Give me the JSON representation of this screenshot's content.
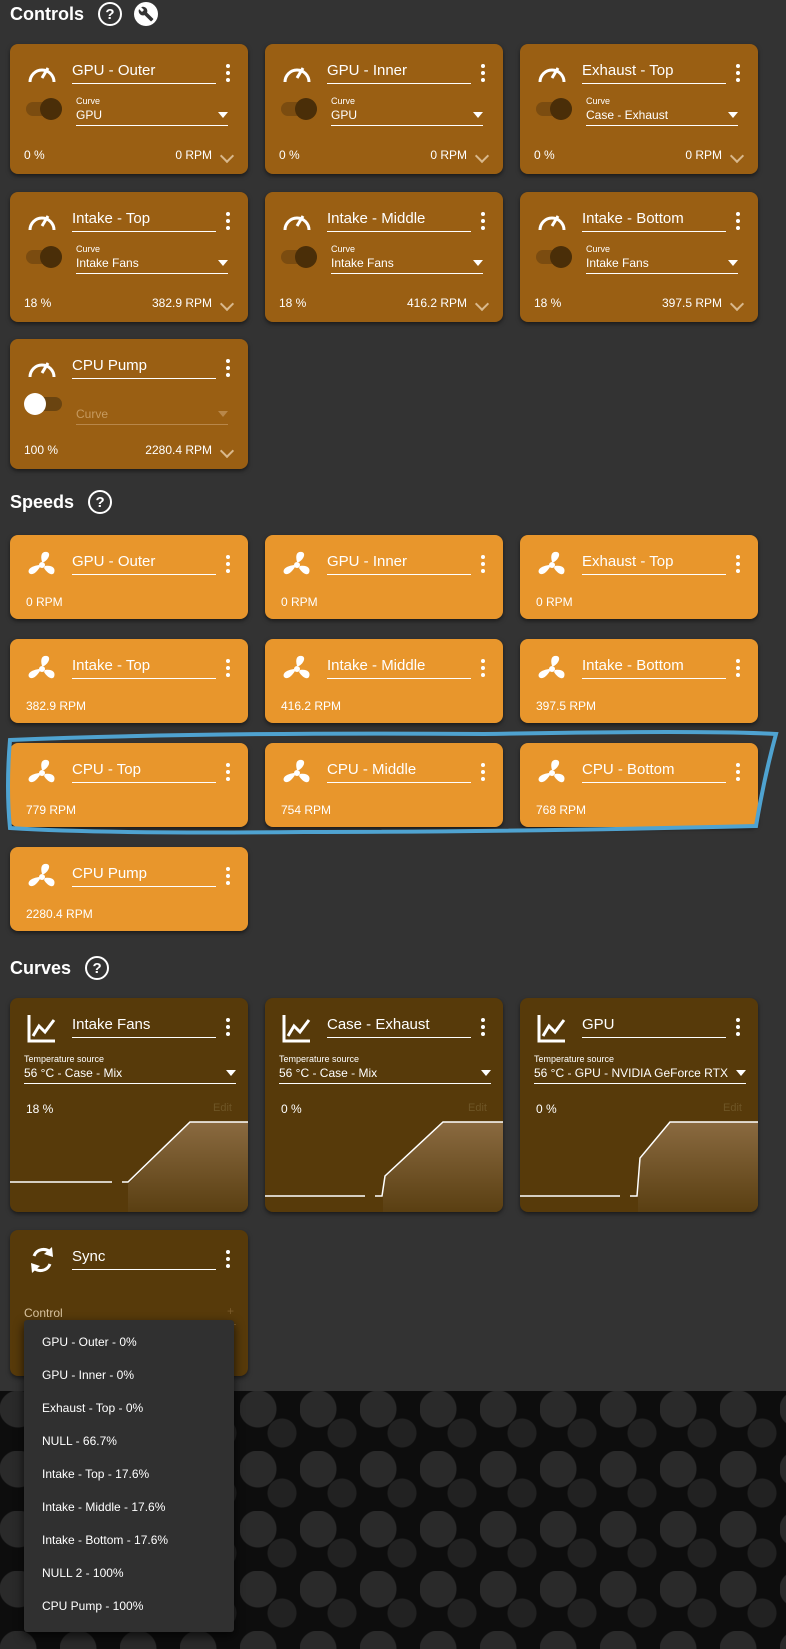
{
  "sections": {
    "controls": "Controls",
    "speeds": "Speeds",
    "curves": "Curves"
  },
  "icons": {
    "help": "?",
    "wrench": "wrench-icon",
    "gauge": "speedometer-icon",
    "fan": "fan-icon",
    "chart": "line-chart-icon",
    "sync": "sync-icon"
  },
  "controls": [
    {
      "name": "GPU - Outer",
      "curve_label": "Curve",
      "curve": "GPU",
      "percent": "0 %",
      "rpm": "0 RPM"
    },
    {
      "name": "GPU - Inner",
      "curve_label": "Curve",
      "curve": "GPU",
      "percent": "0 %",
      "rpm": "0 RPM"
    },
    {
      "name": "Exhaust - Top",
      "curve_label": "Curve",
      "curve": "Case - Exhaust",
      "percent": "0 %",
      "rpm": "0 RPM"
    },
    {
      "name": "Intake - Top",
      "curve_label": "Curve",
      "curve": "Intake Fans",
      "percent": "18 %",
      "rpm": "382.9 RPM"
    },
    {
      "name": "Intake - Middle",
      "curve_label": "Curve",
      "curve": "Intake Fans",
      "percent": "18 %",
      "rpm": "416.2 RPM"
    },
    {
      "name": "Intake - Bottom",
      "curve_label": "Curve",
      "curve": "Intake Fans",
      "percent": "18 %",
      "rpm": "397.5 RPM"
    },
    {
      "name": "CPU Pump",
      "curve_placeholder": "Curve",
      "percent": "100 %",
      "rpm": "2280.4 RPM"
    }
  ],
  "speeds": [
    {
      "name": "GPU - Outer",
      "rpm": "0 RPM"
    },
    {
      "name": "GPU - Inner",
      "rpm": "0 RPM"
    },
    {
      "name": "Exhaust - Top",
      "rpm": "0 RPM"
    },
    {
      "name": "Intake - Top",
      "rpm": "382.9 RPM"
    },
    {
      "name": "Intake - Middle",
      "rpm": "416.2 RPM"
    },
    {
      "name": "Intake - Bottom",
      "rpm": "397.5 RPM"
    },
    {
      "name": "CPU - Top",
      "rpm": "779 RPM"
    },
    {
      "name": "CPU - Middle",
      "rpm": "754 RPM"
    },
    {
      "name": "CPU - Bottom",
      "rpm": "768 RPM"
    },
    {
      "name": "CPU Pump",
      "rpm": "2280.4 RPM"
    }
  ],
  "curves": [
    {
      "name": "Intake Fans",
      "temp_label": "Temperature source",
      "temp_source": "56 °C - Case - Mix",
      "percent": "18 %",
      "edit": "Edit"
    },
    {
      "name": "Case - Exhaust",
      "temp_label": "Temperature source",
      "temp_source": "56 °C - Case - Mix",
      "percent": "0 %",
      "edit": "Edit"
    },
    {
      "name": "GPU",
      "temp_label": "Temperature source",
      "temp_source": "56 °C - GPU - NVIDIA GeForce RTX",
      "percent": "0 %",
      "edit": "Edit"
    }
  ],
  "sync": {
    "name": "Sync",
    "control_label": "Control",
    "add": "+",
    "options": [
      "GPU - Outer - 0%",
      "GPU - Inner - 0%",
      "Exhaust - Top - 0%",
      "NULL - 66.7%",
      "Intake - Top - 17.6%",
      "Intake - Middle - 17.6%",
      "Intake - Bottom - 17.6%",
      "NULL 2 - 100%",
      "CPU Pump - 100%"
    ]
  },
  "colors": {
    "background": "#333333",
    "control_card": "#9a5f13",
    "speed_card": "#e8962c",
    "curve_card": "#573a0a",
    "highlight_stroke": "#4fa3d1"
  }
}
